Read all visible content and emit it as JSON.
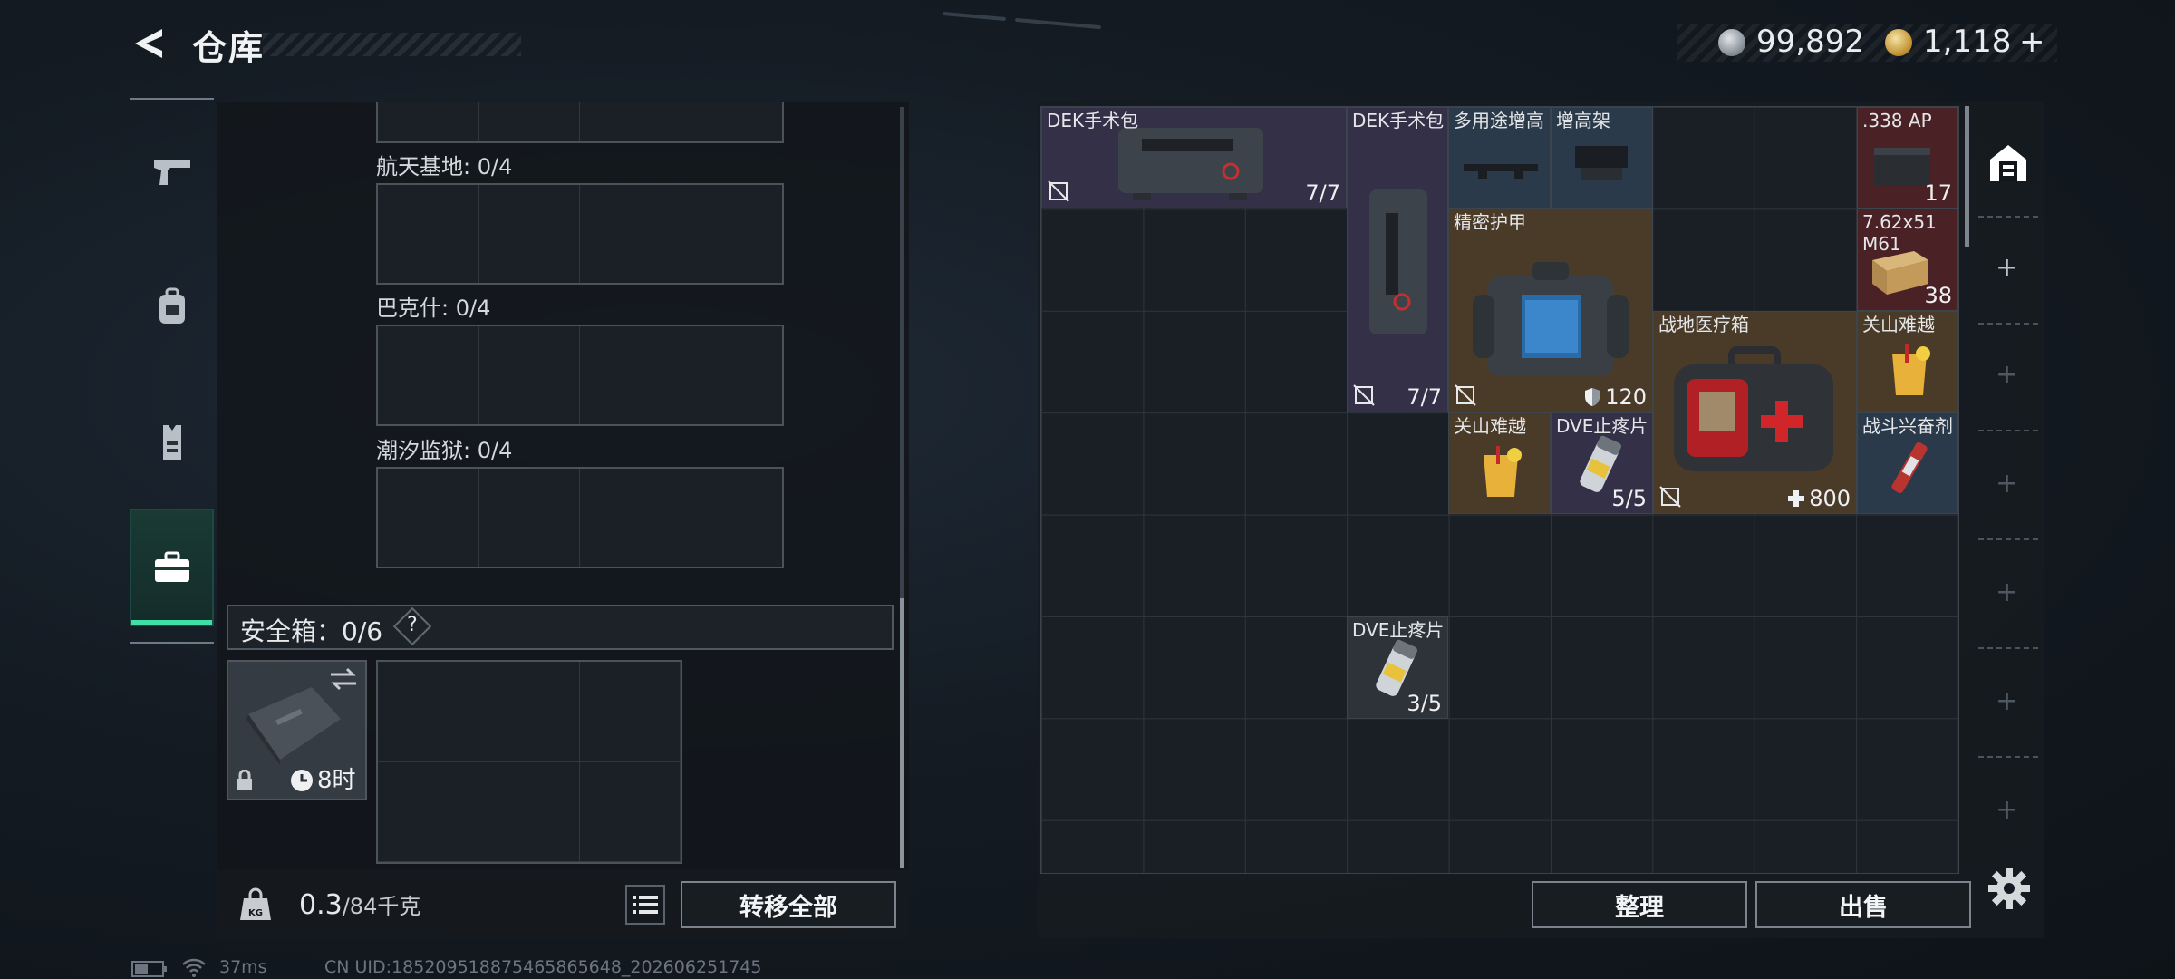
{
  "header": {
    "title": "仓库"
  },
  "currency": {
    "silver": "99,892",
    "gold": "1,118",
    "gold_add": "+"
  },
  "left_panel": {
    "maps": [
      {
        "label": "航天基地: 0/4"
      },
      {
        "label": "巴克什: 0/4"
      },
      {
        "label": "潮汐监狱: 0/4"
      }
    ],
    "safebox": {
      "label": "安全箱：0/6",
      "help": "?",
      "timer": "8时"
    },
    "weight": {
      "current": "0.3",
      "capacity": "/84千克"
    },
    "transfer_all": "转移全部"
  },
  "stash": {
    "items": [
      {
        "name": "DEK手术包",
        "count": "7/7"
      },
      {
        "name": "DEK手术包",
        "count": "7/7"
      },
      {
        "name": "多用途增高"
      },
      {
        "name": "增高架"
      },
      {
        "name": ".338 AP",
        "count": "17"
      },
      {
        "name": "7.62x51 M61",
        "count": "38"
      },
      {
        "name": "精密护甲",
        "count": "120"
      },
      {
        "name": "战地医疗箱",
        "count": "800"
      },
      {
        "name": "关山难越"
      },
      {
        "name": "关山难越"
      },
      {
        "name": "DVE止疼片",
        "count": "5/5"
      },
      {
        "name": "战斗兴奋剂"
      },
      {
        "name": "DVE止疼片",
        "count": "3/5"
      }
    ],
    "sort_button": "整理",
    "sell_button": "出售"
  },
  "status_bar": {
    "ping": "37ms",
    "uid": "CN UID:18520951887546586564​8_202606251745"
  },
  "colors": {
    "accent": "#3fe0a6",
    "panel": "#12161b"
  }
}
